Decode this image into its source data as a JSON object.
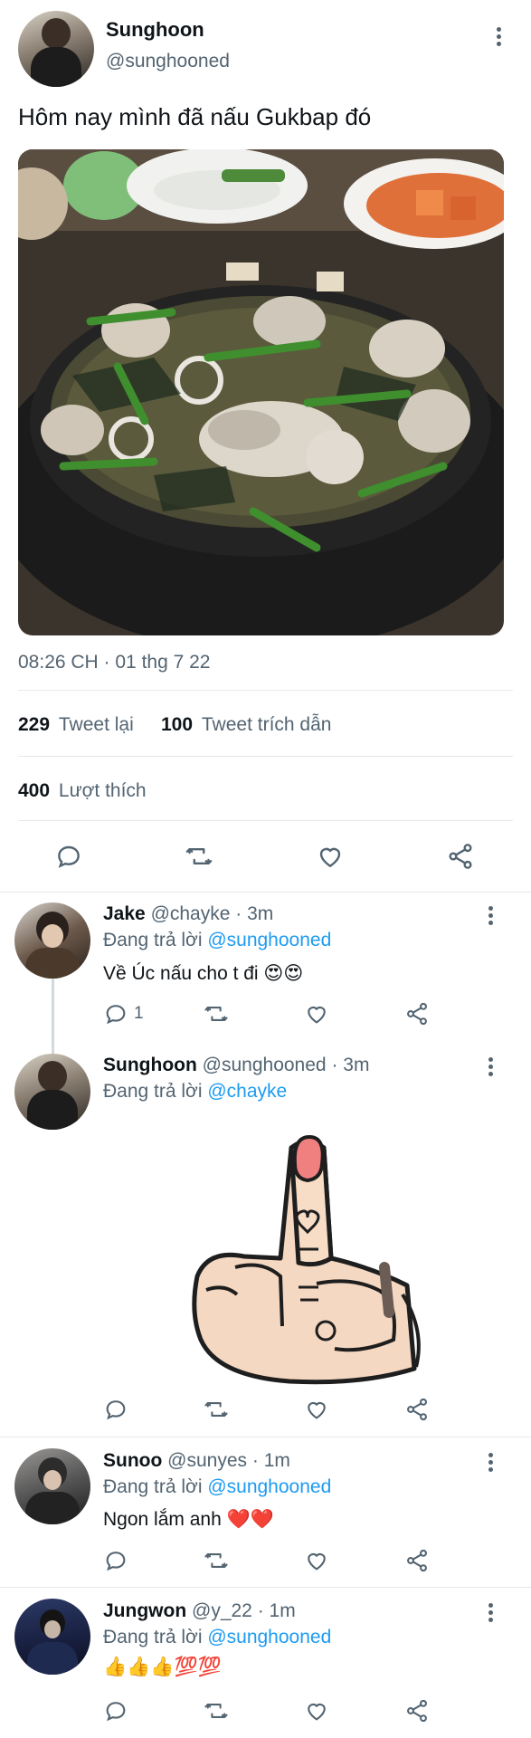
{
  "tweet": {
    "author_name": "Sunghoon",
    "author_handle": "@sunghooned",
    "text": "Hôm nay mình đã nấu Gukbap đó",
    "timestamp": "08:26 CH · 01 thg 7 22",
    "retweets_count": "229",
    "retweets_label": "Tweet lại",
    "quotes_count": "100",
    "quotes_label": "Tweet trích dẫn",
    "likes_count": "400",
    "likes_label": "Lượt thích"
  },
  "replies": [
    {
      "name": "Jake",
      "handle": "@chayke",
      "time": "· 3m",
      "replying_prefix": "Đang trả lời",
      "replying_to": "@sunghooned",
      "text": "Về Úc nấu cho t đi 😍😍",
      "reply_count": "1"
    },
    {
      "name": "Sunghoon",
      "handle": "@sunghooned",
      "time": "· 3m",
      "replying_prefix": "Đang trả lời",
      "replying_to": "@chayke",
      "text": ""
    },
    {
      "name": "Sunoo",
      "handle": "@sunyes",
      "time": "· 1m",
      "replying_prefix": "Đang trả lời",
      "replying_to": "@sunghooned",
      "text": "Ngon lắm anh ❤️❤️"
    },
    {
      "name": "Jungwon",
      "handle": "@y_22",
      "time": "· 1m",
      "replying_prefix": "Đang trả lời",
      "replying_to": "@sunghooned",
      "text": "👍👍👍💯💯"
    }
  ],
  "colors": {
    "link": "#1d9bf0",
    "muted": "#536471",
    "divider": "#e6e9ec"
  }
}
